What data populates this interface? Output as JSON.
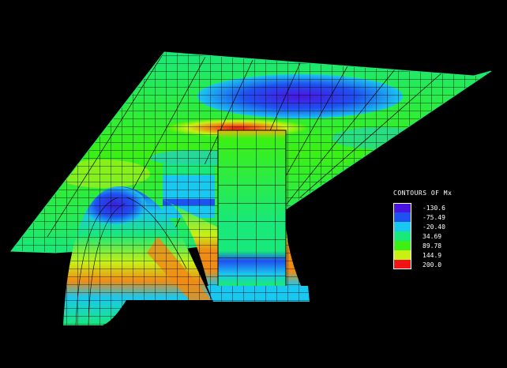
{
  "colors": {
    "background": "#000000",
    "mesh": "#000000",
    "deep_blue": "#3a1fd6",
    "blue": "#1f5ef0",
    "cyan": "#19c8f0",
    "green": "#19e87a",
    "lime": "#3cf014",
    "yellow": "#c8f014",
    "orange": "#f08c14",
    "red": "#f01414"
  },
  "legend": {
    "title": "CONTOURS OF Mx",
    "entries": [
      {
        "value": "-130.6",
        "color": "#4a14e0"
      },
      {
        "value": "-75.49",
        "color": "#1f50f0"
      },
      {
        "value": "-20.40",
        "color": "#19c8f0"
      },
      {
        "value": "34.69",
        "color": "#19e87a"
      },
      {
        "value": "89.78",
        "color": "#3cf014"
      },
      {
        "value": "144.9",
        "color": "#c8f014"
      },
      {
        "value": "200.0",
        "color": "#f01414"
      }
    ]
  }
}
